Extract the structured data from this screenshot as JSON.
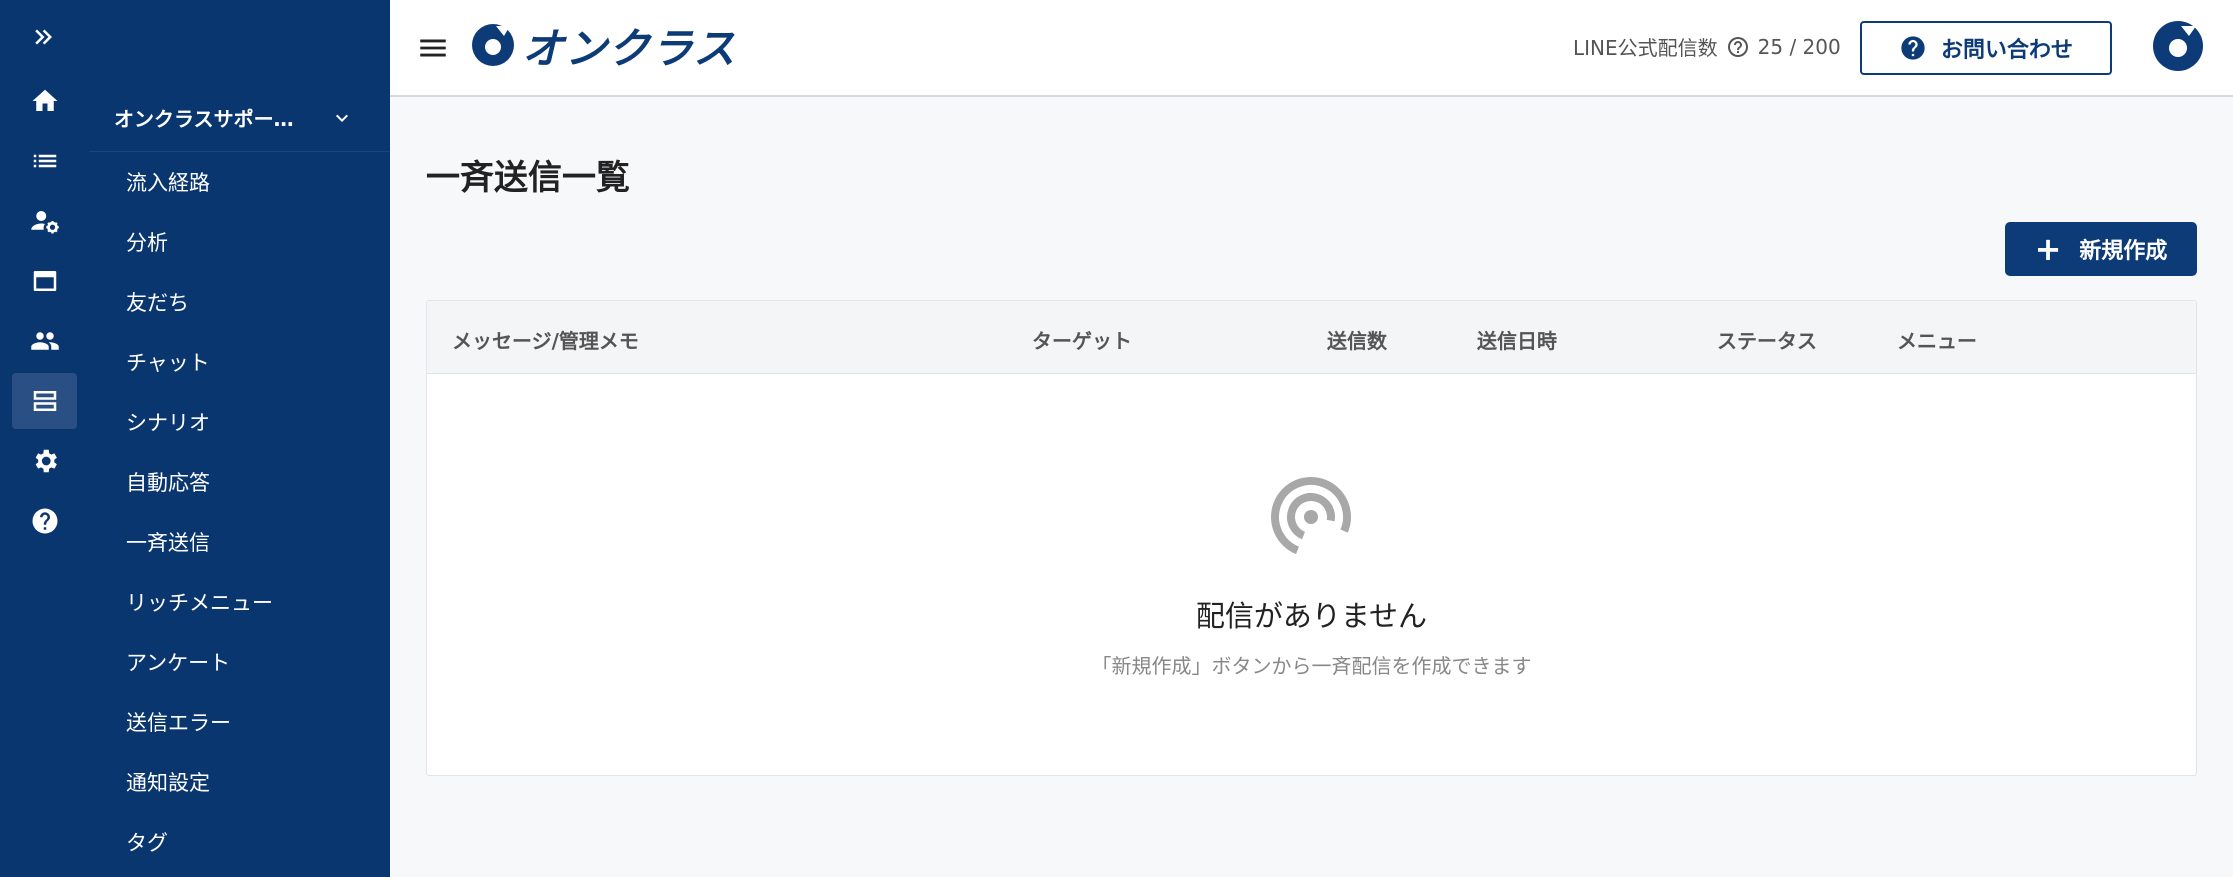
{
  "rail": {
    "icons": [
      "expand-icon",
      "home-icon",
      "list-icon",
      "user-settings-icon",
      "window-icon",
      "people-icon",
      "broadcast-icon",
      "gear-icon",
      "help-icon"
    ],
    "active": "broadcast-icon"
  },
  "sidebar": {
    "account_name": "オンクラスサポー…",
    "items": [
      {
        "label": "流入経路"
      },
      {
        "label": "分析"
      },
      {
        "label": "友だち"
      },
      {
        "label": "チャット"
      },
      {
        "label": "シナリオ"
      },
      {
        "label": "自動応答"
      },
      {
        "label": "一斉送信"
      },
      {
        "label": "リッチメニュー"
      },
      {
        "label": "アンケート"
      },
      {
        "label": "送信エラー"
      },
      {
        "label": "通知設定"
      },
      {
        "label": "タグ"
      }
    ]
  },
  "header": {
    "logo_text": "オンクラス",
    "quota_label": "LINE公式配信数",
    "quota_value": "25 / 200",
    "contact_label": "お問い合わせ"
  },
  "main": {
    "title": "一斉送信一覧",
    "new_button_label": "新規作成",
    "table": {
      "columns": [
        "メッセージ/管理メモ",
        "ターゲット",
        "送信数",
        "送信日時",
        "ステータス",
        "メニュー"
      ],
      "rows": []
    },
    "empty": {
      "title": "配信がありません",
      "subtitle": "「新規作成」ボタンから一斉配信を作成できます"
    }
  },
  "colors": {
    "navy": "#0a3670",
    "brand": "#0d3b78",
    "background": "#f7f8fa"
  }
}
